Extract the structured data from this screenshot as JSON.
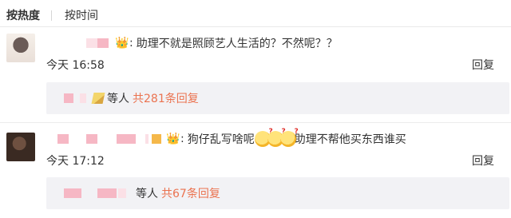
{
  "sort": {
    "hot": "按热度",
    "time": "按时间"
  },
  "comments": [
    {
      "text": "助理不就是照顾艺人生活的？不然呢？？",
      "time": "今天 16:58",
      "reply": "回复",
      "sub": {
        "who": "等人",
        "count": "共281条回复"
      }
    },
    {
      "text_a": "狗仔乱写啥呢",
      "text_b": "助理不帮他买东西谁买",
      "time": "今天 17:12",
      "reply": "回复",
      "sub": {
        "who": "等人",
        "count": "共67条回复"
      }
    }
  ],
  "colors": {
    "accent": "#eb7350",
    "redacted": "#f6b7c4",
    "panel": "#f2f2f5"
  },
  "icons": [
    "vip-badge-icon",
    "emoji-confused-icon"
  ]
}
